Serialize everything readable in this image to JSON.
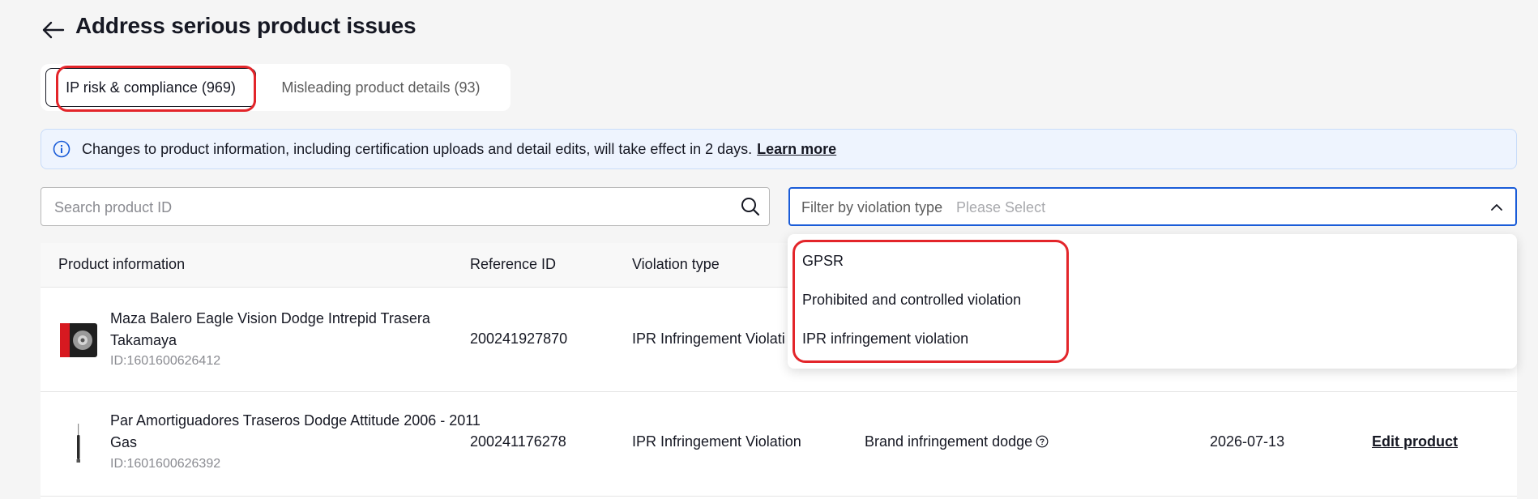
{
  "header": {
    "title": "Address serious product issues"
  },
  "tabs": [
    {
      "label": "IP risk & compliance (969)"
    },
    {
      "label": "Misleading product details (93)"
    }
  ],
  "banner": {
    "text": "Changes to product information, including certification uploads and detail edits, will take effect in 2 days.",
    "link": "Learn more"
  },
  "search": {
    "placeholder": "Search product ID"
  },
  "filter": {
    "label": "Filter by violation type",
    "placeholder": "Please Select"
  },
  "dropdown": {
    "options": [
      "GPSR",
      "Prohibited and controlled violation",
      "IPR infringement violation"
    ]
  },
  "table": {
    "headers": [
      "Product information",
      "Reference ID",
      "Violation type"
    ],
    "rows": [
      {
        "name": "Maza Balero Eagle Vision Dodge Intrepid Trasera Takamaya",
        "id": "ID:1601600626412",
        "reference": "200241927870",
        "violation": "IPR Infringement Violati"
      },
      {
        "name": "Par Amortiguadores Traseros Dodge Attitude 2006 - 2011 Gas",
        "id": "ID:1601600626392",
        "reference": "200241176278",
        "violation": "IPR Infringement Violation",
        "reason": "Brand infringement dodge",
        "date": "2026-07-13",
        "action": "Edit product"
      }
    ]
  },
  "colors": {
    "accent": "#1a5cd8",
    "annotation": "#e3252a",
    "banner_bg": "#eef4fe"
  },
  "icons": [
    "back-arrow-icon",
    "info-icon",
    "search-icon",
    "chevron-up-icon",
    "help-icon"
  ]
}
